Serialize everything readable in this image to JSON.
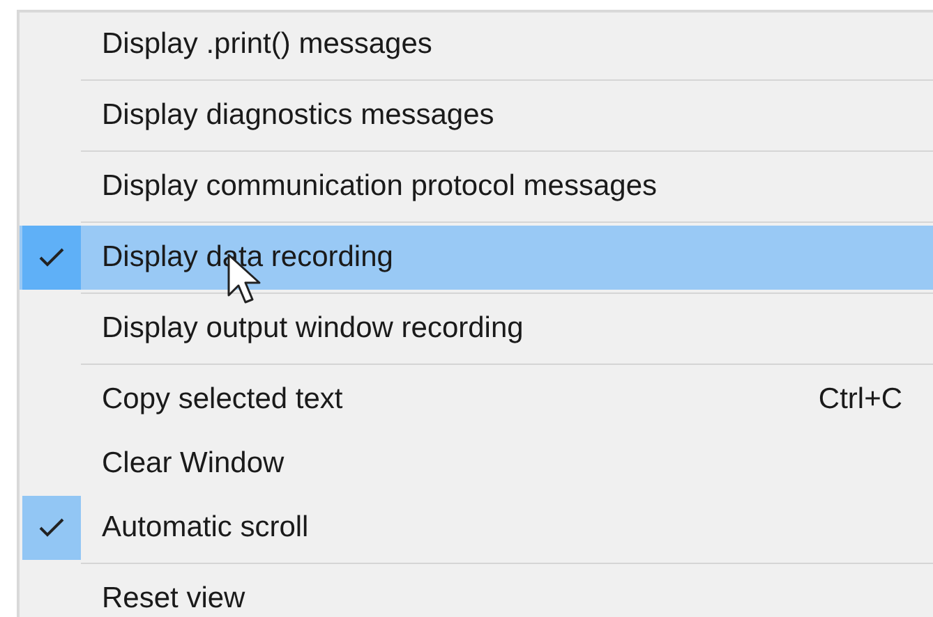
{
  "menu": {
    "items": [
      {
        "kind": "item",
        "label": "Display .print() messages",
        "checked": false,
        "selected": false
      },
      {
        "kind": "separator"
      },
      {
        "kind": "item",
        "label": "Display diagnostics messages",
        "checked": false,
        "selected": false
      },
      {
        "kind": "separator"
      },
      {
        "kind": "item",
        "label": "Display communication protocol messages",
        "checked": false,
        "selected": false
      },
      {
        "kind": "separator"
      },
      {
        "kind": "item",
        "label": "Display data recording",
        "checked": true,
        "selected": true
      },
      {
        "kind": "separator"
      },
      {
        "kind": "item",
        "label": "Display output window recording",
        "checked": false,
        "selected": false
      },
      {
        "kind": "separator"
      },
      {
        "kind": "item",
        "label": "Copy selected text",
        "shortcut": "Ctrl+C",
        "checked": false,
        "selected": false
      },
      {
        "kind": "item",
        "label": "Clear Window",
        "checked": false,
        "selected": false
      },
      {
        "kind": "item",
        "label": "Automatic scroll",
        "checked": true,
        "selected": false
      },
      {
        "kind": "separator"
      },
      {
        "kind": "item",
        "label": "Reset view",
        "checked": false,
        "selected": false
      }
    ]
  }
}
